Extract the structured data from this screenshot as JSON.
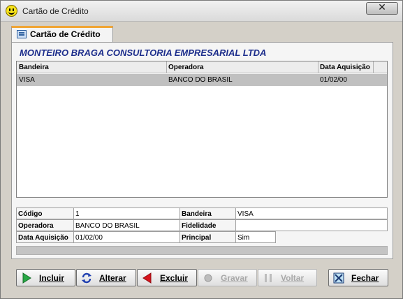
{
  "window": {
    "title": "Cartão de Crédito",
    "close_glyph": "✕",
    "icon": "smiley-icon"
  },
  "tab": {
    "label": "Cartão de Crédito",
    "icon": "card-list-icon"
  },
  "company": "MONTEIRO BRAGA CONSULTORIA EMPRESARIAL LTDA",
  "grid": {
    "columns": [
      "Bandeira",
      "Operadora",
      "Data Aquisição"
    ],
    "rows": [
      {
        "bandeira": "VISA",
        "operadora": "BANCO DO BRASIL",
        "data": "01/02/00"
      }
    ]
  },
  "detail": {
    "codigo_label": "Código",
    "codigo_value": "1",
    "bandeira_label": "Bandeira",
    "bandeira_value": "VISA",
    "operadora_label": "Operadora",
    "operadora_value": "BANCO DO BRASIL",
    "fidelidade_label": "Fidelidade",
    "fidelidade_value": "",
    "data_label": "Data Aquisição",
    "data_value": "01/02/00",
    "principal_label": "Principal",
    "principal_value": "Sim"
  },
  "buttons": {
    "incluir": "Incluir",
    "alterar": "Alterar",
    "excluir": "Excluir",
    "gravar": "Gravar",
    "voltar": "Voltar",
    "fechar": "Fechar"
  },
  "colors": {
    "accent": "#1d2e8c",
    "tab_highlight": "#f0a534"
  }
}
